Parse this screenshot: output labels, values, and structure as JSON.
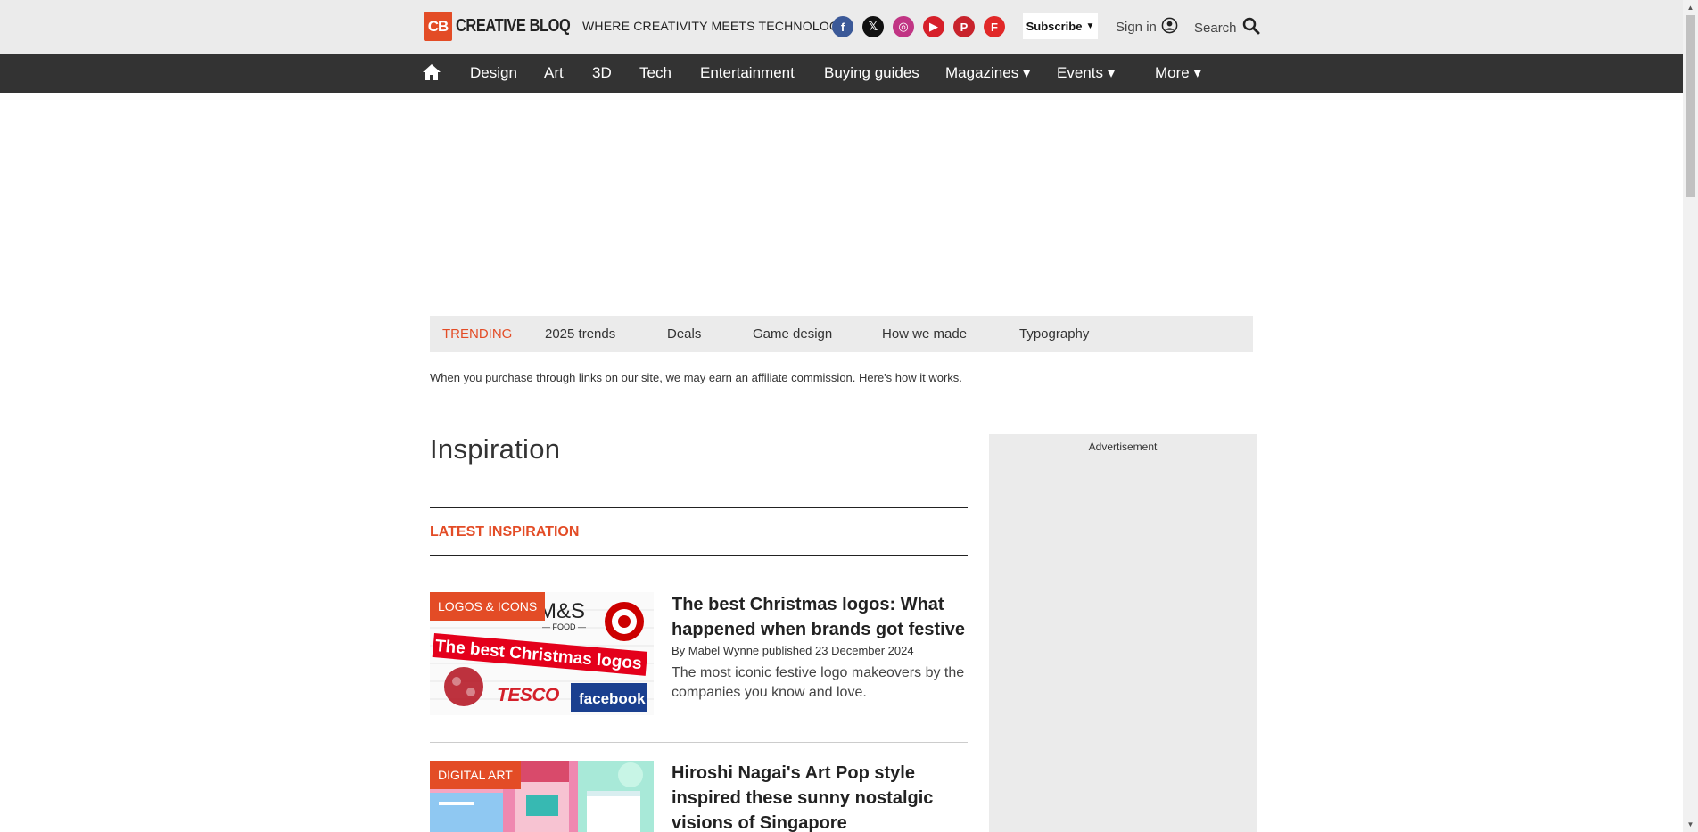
{
  "header": {
    "logo_mark": "CB",
    "logo_word": "CREATIVE BLOQ",
    "tagline": "WHERE CREATIVITY MEETS TECHNOLOGY",
    "socials": [
      {
        "name": "facebook-icon",
        "glyph": "f",
        "color": "#3b5998"
      },
      {
        "name": "x-icon",
        "glyph": "𝕏",
        "color": "#111111"
      },
      {
        "name": "instagram-icon",
        "glyph": "◎",
        "color": "#c13584"
      },
      {
        "name": "youtube-icon",
        "glyph": "▶",
        "color": "#d6202a"
      },
      {
        "name": "pinterest-icon",
        "glyph": "P",
        "color": "#c8232c"
      },
      {
        "name": "flipboard-icon",
        "glyph": "F",
        "color": "#e12828"
      }
    ],
    "subscribe_label": "Subscribe",
    "signin_label": "Sign in",
    "search_label": "Search"
  },
  "nav": {
    "items": [
      "Design",
      "Art",
      "3D",
      "Tech",
      "Entertainment",
      "Buying guides",
      "Magazines ▾",
      "Events ▾",
      "More ▾"
    ]
  },
  "trending": {
    "label": "TRENDING",
    "items": [
      "2025 trends",
      "Deals",
      "Game design",
      "How we made",
      "Typography"
    ]
  },
  "affiliate": {
    "text": "When you purchase through links on our site, we may earn an affiliate commission. ",
    "link": "Here's how it works",
    "suffix": "."
  },
  "page": {
    "title": "Inspiration",
    "section_label": "LATEST INSPIRATION"
  },
  "articles": [
    {
      "badge": "LOGOS & ICONS",
      "title": "The best Christmas logos: What happened when brands got festive",
      "byline": "By Mabel Wynne published 23 December 2024",
      "description": "The most iconic festive logo makeovers by the companies you know and love.",
      "thumb_text": {
        "ms": "M&S",
        "ms_sub": "— FOOD —",
        "banner": "The best Christmas logos",
        "tesco": "TESCO",
        "facebook": "facebook"
      }
    },
    {
      "badge": "DIGITAL ART",
      "title": "Hiroshi Nagai's Art Pop style inspired these sunny nostalgic visions of Singapore"
    }
  ],
  "sidebar": {
    "ad_label": "Advertisement"
  },
  "colors": {
    "accent": "#e34c26",
    "nav_bg": "#333333",
    "header_bg": "#ebebeb"
  }
}
